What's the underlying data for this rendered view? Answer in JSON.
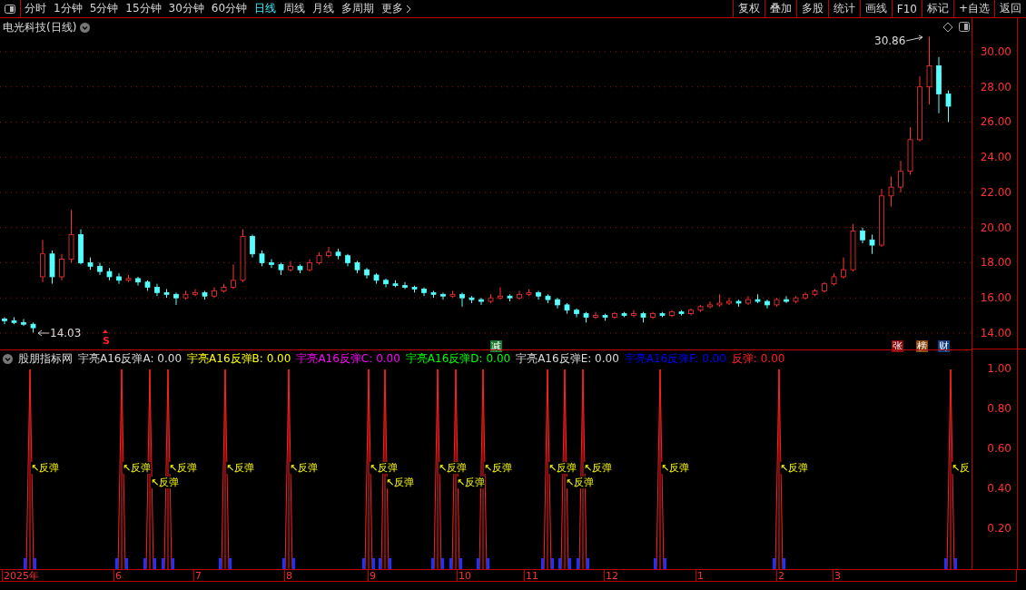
{
  "toolbar": {
    "periods": [
      {
        "label": "分时",
        "selected": false
      },
      {
        "label": "1分钟",
        "selected": false
      },
      {
        "label": "5分钟",
        "selected": false
      },
      {
        "label": "15分钟",
        "selected": false
      },
      {
        "label": "30分钟",
        "selected": false
      },
      {
        "label": "60分钟",
        "selected": false
      },
      {
        "label": "日线",
        "selected": true
      },
      {
        "label": "周线",
        "selected": false
      },
      {
        "label": "月线",
        "selected": false
      },
      {
        "label": "多周期",
        "selected": false
      },
      {
        "label": "更多",
        "selected": false
      }
    ],
    "buttons": [
      "复权",
      "叠加",
      "多股",
      "统计",
      "画线",
      "F10",
      "标记",
      "+自选",
      "返回"
    ]
  },
  "price_panel": {
    "title": "电光科技(日线)",
    "high_label": "30.86",
    "low_label": "14.03",
    "chart_data": {
      "type": "candlestick",
      "ylim": [
        0.52,
        31.91
      ],
      "grid": true,
      "yticks": [
        {
          "value": 30,
          "label": "30.00"
        },
        {
          "value": 28,
          "label": "28.00"
        },
        {
          "value": 26,
          "label": "26.00"
        },
        {
          "value": 24,
          "label": "24.00"
        },
        {
          "value": 22,
          "label": "22.00"
        },
        {
          "value": 20,
          "label": "20.00"
        },
        {
          "value": 18,
          "label": "18.00"
        },
        {
          "value": 16,
          "label": "16.00"
        },
        {
          "value": 14,
          "label": "14.00"
        }
      ],
      "ohlc": [
        [
          14.8,
          14.9,
          14.5,
          14.7
        ],
        [
          14.7,
          14.9,
          14.5,
          14.6
        ],
        [
          14.6,
          14.8,
          14.4,
          14.5
        ],
        [
          14.5,
          14.6,
          14.03,
          14.3
        ],
        [
          17.2,
          19.3,
          16.9,
          18.5
        ],
        [
          18.5,
          18.7,
          16.8,
          17.2
        ],
        [
          17.2,
          18.5,
          17.0,
          18.2
        ],
        [
          18.2,
          21.0,
          18.0,
          19.6
        ],
        [
          19.6,
          19.9,
          17.9,
          18.0
        ],
        [
          18.0,
          18.3,
          17.6,
          17.8
        ],
        [
          17.8,
          18.0,
          17.3,
          17.5
        ],
        [
          17.5,
          17.7,
          17.0,
          17.2
        ],
        [
          17.2,
          17.4,
          16.8,
          17.0
        ],
        [
          17.0,
          17.3,
          16.9,
          17.1
        ],
        [
          17.1,
          17.2,
          16.7,
          16.9
        ],
        [
          16.9,
          17.0,
          16.4,
          16.6
        ],
        [
          16.6,
          16.8,
          16.1,
          16.3
        ],
        [
          16.3,
          16.5,
          16.0,
          16.2
        ],
        [
          16.2,
          16.3,
          15.6,
          16.0
        ],
        [
          16.0,
          16.4,
          15.9,
          16.2
        ],
        [
          16.2,
          16.5,
          16.1,
          16.3
        ],
        [
          16.3,
          16.4,
          15.9,
          16.1
        ],
        [
          16.1,
          16.6,
          16.0,
          16.4
        ],
        [
          16.4,
          16.8,
          16.3,
          16.6
        ],
        [
          16.6,
          17.9,
          16.5,
          17.0
        ],
        [
          17.0,
          19.9,
          16.9,
          19.5
        ],
        [
          19.5,
          19.6,
          18.3,
          18.5
        ],
        [
          18.5,
          18.7,
          17.8,
          18.0
        ],
        [
          18.0,
          18.2,
          17.7,
          17.9
        ],
        [
          17.9,
          18.0,
          17.3,
          17.6
        ],
        [
          17.6,
          18.1,
          17.5,
          17.8
        ],
        [
          17.8,
          17.9,
          17.4,
          17.6
        ],
        [
          17.6,
          18.2,
          17.5,
          18.0
        ],
        [
          18.0,
          18.6,
          17.9,
          18.4
        ],
        [
          18.4,
          18.9,
          18.3,
          18.6
        ],
        [
          18.6,
          18.8,
          18.2,
          18.4
        ],
        [
          18.4,
          18.5,
          17.8,
          18.0
        ],
        [
          18.0,
          18.1,
          17.4,
          17.6
        ],
        [
          17.6,
          17.7,
          17.1,
          17.3
        ],
        [
          17.3,
          17.4,
          16.8,
          17.0
        ],
        [
          17.0,
          17.1,
          16.6,
          16.8
        ],
        [
          16.8,
          17.0,
          16.6,
          16.7
        ],
        [
          16.7,
          16.9,
          16.5,
          16.6
        ],
        [
          16.6,
          16.7,
          16.3,
          16.5
        ],
        [
          16.5,
          16.6,
          16.1,
          16.3
        ],
        [
          16.3,
          16.4,
          16.0,
          16.2
        ],
        [
          16.2,
          16.3,
          15.9,
          16.1
        ],
        [
          16.1,
          16.4,
          16.0,
          16.2
        ],
        [
          16.2,
          16.3,
          15.5,
          16.0
        ],
        [
          16.0,
          16.1,
          15.7,
          15.9
        ],
        [
          15.9,
          16.0,
          15.6,
          15.8
        ],
        [
          15.8,
          16.2,
          15.7,
          16.0
        ],
        [
          16.0,
          16.6,
          15.9,
          16.1
        ],
        [
          16.1,
          16.2,
          15.8,
          16.0
        ],
        [
          16.0,
          16.4,
          15.9,
          16.2
        ],
        [
          16.2,
          16.5,
          16.1,
          16.3
        ],
        [
          16.3,
          16.4,
          15.9,
          16.1
        ],
        [
          16.1,
          16.2,
          15.7,
          15.9
        ],
        [
          15.9,
          16.0,
          15.4,
          15.6
        ],
        [
          15.6,
          15.7,
          15.1,
          15.3
        ],
        [
          15.3,
          15.4,
          14.9,
          15.1
        ],
        [
          15.1,
          15.2,
          14.6,
          14.9
        ],
        [
          14.9,
          15.2,
          14.8,
          15.0
        ],
        [
          15.0,
          15.1,
          14.7,
          14.9
        ],
        [
          14.9,
          15.2,
          14.8,
          15.1
        ],
        [
          15.1,
          15.2,
          14.9,
          15.0
        ],
        [
          15.0,
          15.3,
          14.9,
          15.1
        ],
        [
          15.1,
          15.2,
          14.6,
          14.9
        ],
        [
          14.9,
          15.2,
          14.8,
          15.1
        ],
        [
          15.1,
          15.2,
          14.9,
          15.0
        ],
        [
          15.0,
          15.3,
          14.9,
          15.2
        ],
        [
          15.2,
          15.3,
          15.0,
          15.1
        ],
        [
          15.1,
          15.4,
          15.0,
          15.3
        ],
        [
          15.3,
          15.6,
          15.2,
          15.5
        ],
        [
          15.5,
          15.8,
          15.4,
          15.6
        ],
        [
          15.6,
          16.2,
          15.5,
          15.7
        ],
        [
          15.7,
          16.0,
          15.6,
          15.8
        ],
        [
          15.8,
          15.9,
          15.5,
          15.7
        ],
        [
          15.7,
          16.1,
          15.6,
          15.9
        ],
        [
          15.9,
          16.2,
          15.7,
          15.8
        ],
        [
          15.8,
          15.9,
          15.4,
          15.6
        ],
        [
          15.6,
          16.0,
          15.5,
          15.9
        ],
        [
          15.9,
          16.1,
          15.7,
          15.8
        ],
        [
          15.8,
          16.1,
          15.7,
          16.0
        ],
        [
          16.0,
          16.3,
          15.9,
          16.2
        ],
        [
          16.2,
          16.5,
          16.1,
          16.4
        ],
        [
          16.4,
          16.9,
          16.3,
          16.8
        ],
        [
          16.8,
          17.4,
          16.7,
          17.2
        ],
        [
          17.2,
          18.3,
          17.1,
          17.6
        ],
        [
          17.6,
          20.2,
          17.5,
          19.8
        ],
        [
          19.8,
          20.0,
          19.1,
          19.3
        ],
        [
          19.3,
          19.6,
          18.5,
          19.0
        ],
        [
          19.0,
          22.2,
          18.9,
          21.8
        ],
        [
          21.8,
          22.9,
          21.2,
          22.3
        ],
        [
          22.3,
          23.8,
          22.0,
          23.2
        ],
        [
          23.2,
          25.7,
          23.0,
          25.0
        ],
        [
          25.0,
          28.6,
          24.9,
          28.0
        ],
        [
          28.0,
          30.86,
          27.0,
          29.2
        ],
        [
          29.2,
          29.7,
          26.5,
          27.6
        ],
        [
          27.6,
          27.8,
          26.0,
          26.9
        ]
      ]
    },
    "markers": [
      {
        "text": "S",
        "kind": "signal",
        "color": "#ff2020"
      },
      {
        "text": "减",
        "kind": "tag",
        "color": "#1a7a30"
      },
      {
        "text": "张",
        "kind": "tag",
        "color": "#8a0c0c"
      },
      {
        "text": "榜",
        "kind": "tag",
        "color": "#8a4a10"
      },
      {
        "text": "财",
        "kind": "tag",
        "color": "#123f80"
      }
    ]
  },
  "indicator_panel": {
    "name": "股朋指标网",
    "values": [
      {
        "label": "宇亮A16反弹A:",
        "value": "0.00",
        "color": "#dcdcdc"
      },
      {
        "label": "宇亮A16反弹B:",
        "value": "0.00",
        "color": "#ffff00"
      },
      {
        "label": "宇亮A16反弹C:",
        "value": "0.00",
        "color": "#ff00ff"
      },
      {
        "label": "宇亮A16反弹D:",
        "value": "0.00",
        "color": "#00ff00"
      },
      {
        "label": "宇亮A16反弹E:",
        "value": "0.00",
        "color": "#dcdcdc"
      },
      {
        "label": "宇亮A16反弹F:",
        "value": "0.00",
        "color": "#0000ff"
      },
      {
        "label": "反弹:",
        "value": "0.00",
        "color": "#ff2020"
      }
    ],
    "signals": [
      {
        "label": "↖反弹"
      },
      {
        "label": "↖反弹"
      },
      {
        "label": "↖反弹"
      },
      {
        "label": "↖反弹"
      },
      {
        "label": "↖反弹"
      },
      {
        "label": "↖反弹"
      },
      {
        "label": "↖反弹"
      },
      {
        "label": "↖反弹"
      },
      {
        "label": "↖反弹"
      },
      {
        "label": "↖反弹"
      },
      {
        "label": "↖反弹"
      },
      {
        "label": "↖反弹"
      },
      {
        "label": "↖反弹"
      },
      {
        "label": "↖反弹"
      },
      {
        "label": "↖反弹"
      },
      {
        "label": "↖反弹"
      },
      {
        "label": "↖反"
      }
    ],
    "yticks": [
      "1.00",
      "0.80",
      "0.60",
      "0.40",
      "0.20"
    ]
  },
  "time_axis": [
    "2025年",
    "6",
    "7",
    "8",
    "9",
    "10",
    "11",
    "12",
    "1",
    "2",
    "3"
  ]
}
